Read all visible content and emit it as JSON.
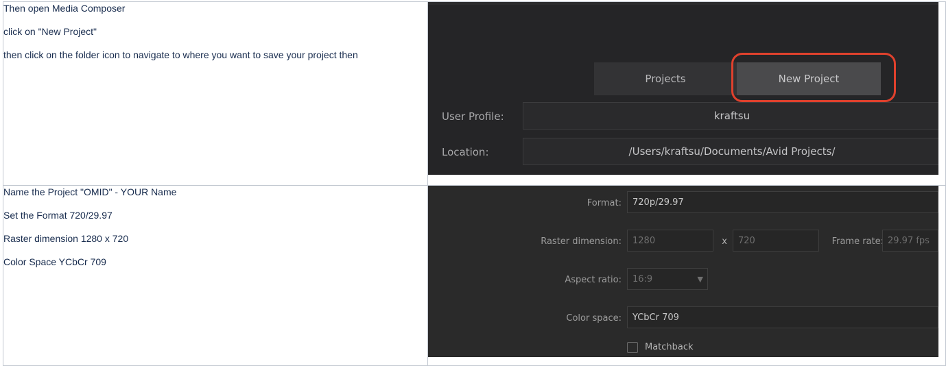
{
  "rows": [
    {
      "paragraphs": [
        "Then open Media Composer",
        "click on \"New Project\"",
        "then click on the folder icon to navigate to where you want to save your project then"
      ]
    },
    {
      "paragraphs": [
        "Name the Project \"OMID\" - YOUR Name",
        "Set the Format 720/29.97",
        "Raster dimension 1280 x 720",
        "Color Space YCbCr 709"
      ]
    }
  ],
  "screenshot1": {
    "tab_projects": "Projects",
    "tab_new_project": "New Project",
    "user_profile_label": "User Profile:",
    "user_profile_value": "kraftsu",
    "location_label": "Location:",
    "location_value": "/Users/kraftsu/Documents/Avid Projects/",
    "highlight_color": "#e0412d"
  },
  "screenshot2": {
    "format_label": "Format:",
    "format_value": "720p/29.97",
    "raster_label": "Raster dimension:",
    "raster_width": "1280",
    "raster_x": "x",
    "raster_height": "720",
    "frame_rate_label": "Frame rate:",
    "frame_rate_value": "29.97 fps",
    "aspect_label": "Aspect ratio:",
    "aspect_value": "16:9",
    "color_space_label": "Color space:",
    "color_space_value": "YCbCr 709",
    "matchback_label": "Matchback"
  }
}
